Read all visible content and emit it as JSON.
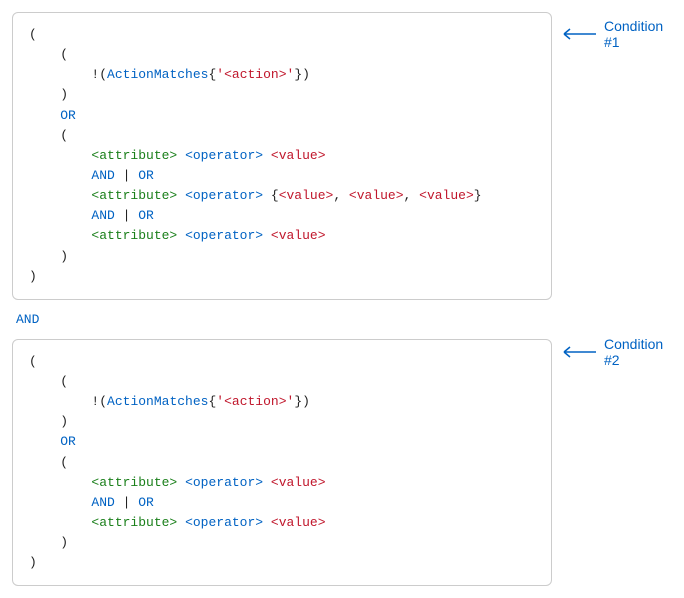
{
  "callouts": {
    "c1": "Condition #1",
    "c2": "Condition #2"
  },
  "between": {
    "and": "AND"
  },
  "tok": {
    "open": "(",
    "close": ")",
    "bang": "!",
    "actionMatches": "ActionMatches",
    "openBrace": "{",
    "closeBrace": "}",
    "openBraceCurly": "{",
    "closeBraceCurly": "}",
    "quote": "'",
    "action": "<action>",
    "or": "OR",
    "and": "AND",
    "pipe": " | ",
    "attribute": "<attribute>",
    "operator": "<operator>",
    "value": "<value>",
    "comma": ", "
  }
}
